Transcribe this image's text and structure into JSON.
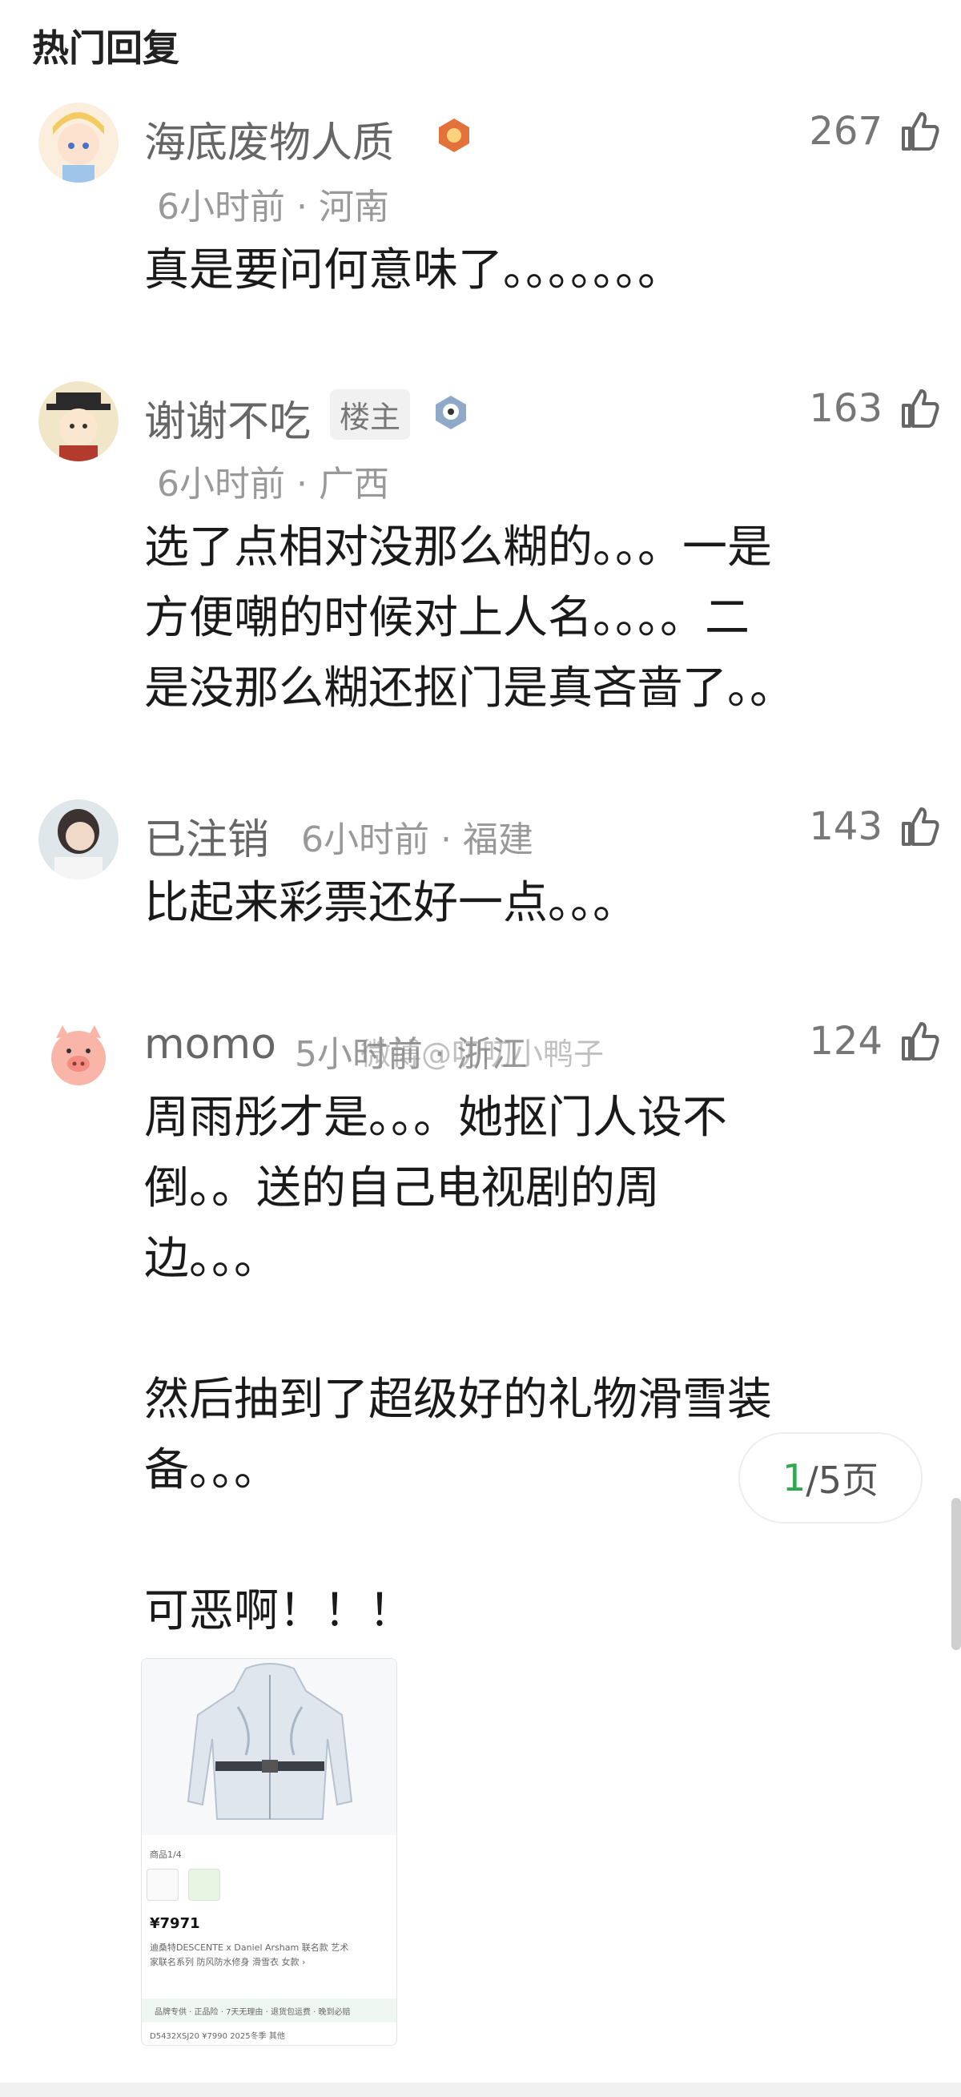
{
  "header": {
    "title": "热门回复"
  },
  "comments": [
    {
      "username": "海底废物人质",
      "meta": "6小时前 · 河南",
      "likes": "267",
      "lines": [
        "真是要问何意味了。。。。。。。"
      ]
    },
    {
      "username": "谢谢不吃",
      "tag": "楼主",
      "meta": "6小时前 · 广西",
      "likes": "163",
      "lines": [
        "选了点相对没那么糊的。。。一是",
        "方便嘲的时候对上人名。。。。二",
        "是没那么糊还抠门是真吝啬了。。"
      ]
    },
    {
      "username": "已注销",
      "meta": "6小时前 · 福建",
      "likes": "143",
      "lines": [
        "比起来彩票还好一点。。。"
      ]
    },
    {
      "username": "momo",
      "meta": "5小时前 · 浙江",
      "likes": "124",
      "lines": [
        "周雨彤才是。。。她抠门人设不",
        "倒。。送的自己电视剧的周",
        "边。。。",
        "",
        "然后抽到了超级好的礼物滑雪装",
        "备。。。",
        "",
        "可恶啊！！！"
      ]
    }
  ],
  "watermark": "微博@叨叨小鸭子",
  "pager": {
    "current": "1",
    "rest": "/5页"
  },
  "product": {
    "counter": "商品1/4",
    "price": "¥7971",
    "name_line1": "迪桑特DESCENTE x Daniel Arsham 联名款 艺术",
    "name_line2": "家联名系列 防风防水修身 滑雪衣 女款 ›",
    "service": "品牌专供 · 正品险 · 7天无理由 · 退货包运费 · 晚到必赔",
    "spec": "D5432XSJ20    ¥7990    2025冬季    其他"
  },
  "colors": {
    "accent": "#2fa84f",
    "muted": "#999999",
    "text": "#1a1a1a"
  }
}
